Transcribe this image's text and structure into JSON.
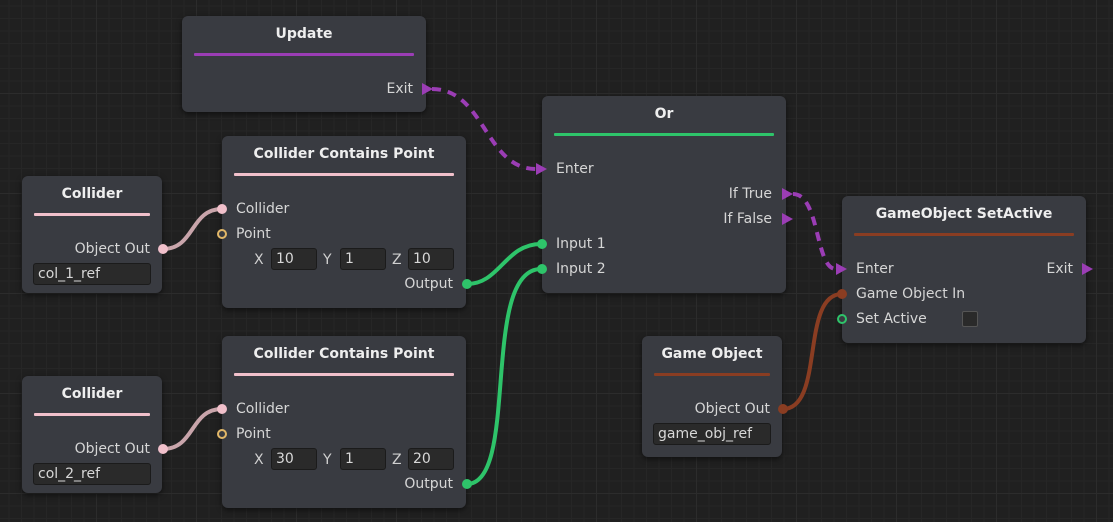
{
  "colors": {
    "flow": "#9b3db5",
    "bool": "#2ec46a",
    "collider": "#f1c0cb",
    "vector": "#e3b868",
    "gameobject": "#8a3d22"
  },
  "update": {
    "title": "Update",
    "exit": "Exit"
  },
  "or": {
    "title": "Or",
    "enter": "Enter",
    "if_true": "If True",
    "if_false": "If False",
    "input1": "Input 1",
    "input2": "Input 2"
  },
  "collider1": {
    "title": "Collider",
    "out": "Object Out",
    "value": "col_1_ref"
  },
  "collider2": {
    "title": "Collider",
    "out": "Object Out",
    "value": "col_2_ref"
  },
  "ccp1": {
    "title": "Collider Contains Point",
    "collider": "Collider",
    "point": "Point",
    "x_label": "X",
    "y_label": "Y",
    "z_label": "Z",
    "x": "10",
    "y": "1",
    "z": "10",
    "output": "Output"
  },
  "ccp2": {
    "title": "Collider Contains Point",
    "collider": "Collider",
    "point": "Point",
    "x_label": "X",
    "y_label": "Y",
    "z_label": "Z",
    "x": "30",
    "y": "1",
    "z": "20",
    "output": "Output"
  },
  "setactive": {
    "title": "GameObject SetActive",
    "enter": "Enter",
    "exit": "Exit",
    "gameobject_in": "Game Object In",
    "set_active": "Set Active"
  },
  "gameobject": {
    "title": "Game Object",
    "out": "Object Out",
    "value": "game_obj_ref"
  }
}
